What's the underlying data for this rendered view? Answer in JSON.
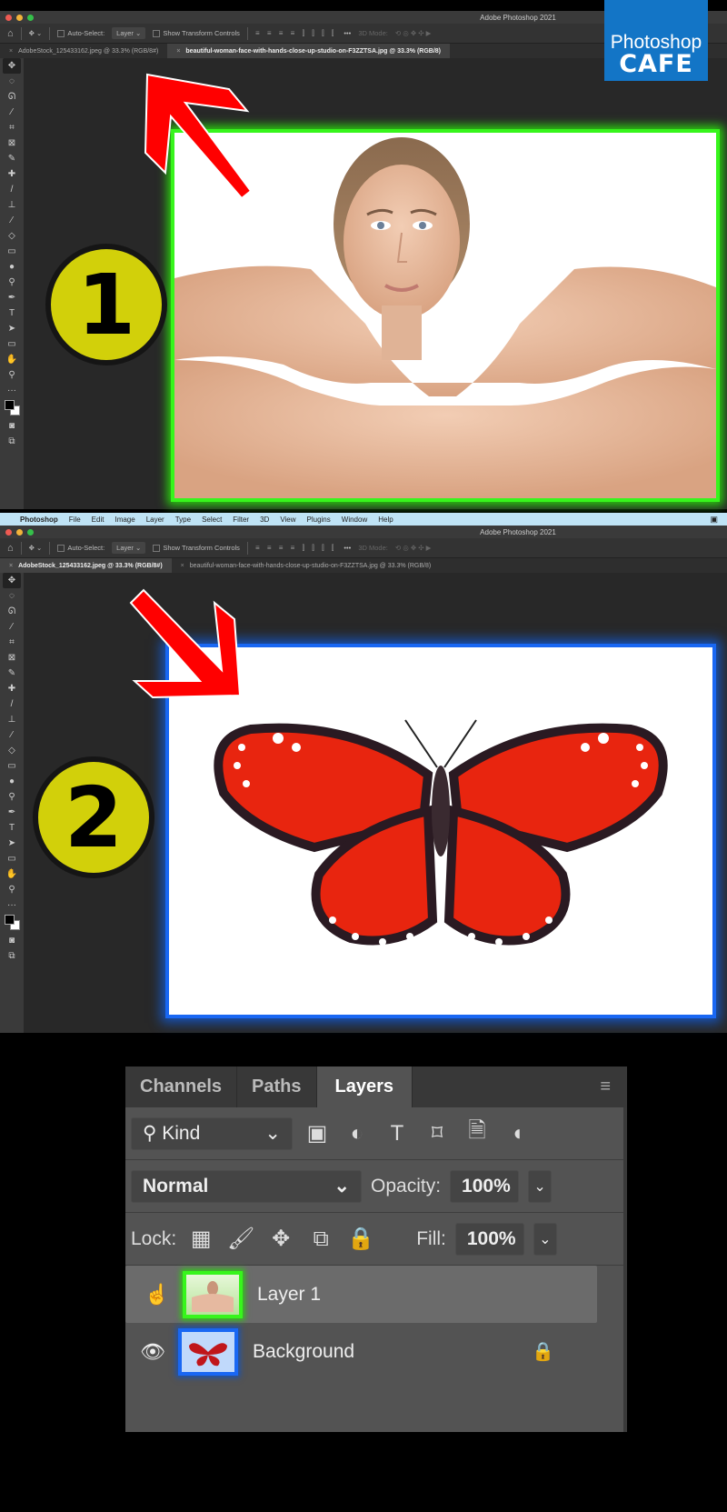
{
  "screens": [
    {
      "window_title": "Adobe Photoshop 2021",
      "options_bar": {
        "auto_select_label": "Auto-Select:",
        "auto_select_value": "Layer",
        "show_transform_label": "Show Transform Controls",
        "more_label": "•••",
        "mode_3d_label": "3D Mode:"
      },
      "tabs": [
        {
          "label": "AdobeStock_125433162.jpeg @ 33.3% (RGB/8#)",
          "active": false
        },
        {
          "label": "beautiful-woman-face-with-hands-close-up-studio-on-F3ZZTSA.jpg @ 33.3% (RGB/8)",
          "active": true
        }
      ],
      "step_badge": "1",
      "document_content": "woman-face-with-hands-photo",
      "highlight_color": "#37f51c"
    },
    {
      "menu_bar": {
        "apple": "",
        "items": [
          "Photoshop",
          "File",
          "Edit",
          "Image",
          "Layer",
          "Type",
          "Select",
          "Filter",
          "3D",
          "View",
          "Plugins",
          "Window",
          "Help"
        ]
      },
      "window_title": "Adobe Photoshop 2021",
      "options_bar": {
        "auto_select_label": "Auto-Select:",
        "auto_select_value": "Layer",
        "show_transform_label": "Show Transform Controls",
        "more_label": "•••",
        "mode_3d_label": "3D Mode:"
      },
      "tabs": [
        {
          "label": "AdobeStock_125433162.jpeg @ 33.3% (RGB/8#)",
          "active": true
        },
        {
          "label": "beautiful-woman-face-with-hands-close-up-studio-on-F3ZZTSA.jpg @ 33.3% (RGB/8)",
          "active": false
        }
      ],
      "step_badge": "2",
      "document_content": "red-butterfly-photo",
      "highlight_color": "#1967f3"
    }
  ],
  "toolbar_tools": [
    "move",
    "marquee",
    "lasso",
    "magic-wand",
    "crop",
    "frame",
    "eyedropper",
    "healing",
    "brush",
    "stamp",
    "history-brush",
    "eraser",
    "gradient",
    "blur",
    "dodge",
    "pen",
    "type",
    "path-select",
    "rectangle",
    "hand",
    "zoom",
    "more"
  ],
  "toolbar_glyphs": [
    "✥",
    "◌",
    "ᘏ",
    "⁄",
    "⌗",
    "⊠",
    "✎",
    "✚",
    "/",
    "⊥",
    "⁄",
    "◇",
    "▭",
    "●",
    "⚲",
    "✒",
    "T",
    "➤",
    "▭",
    "✋",
    "⚲",
    "···"
  ],
  "logo": {
    "line1": "Photoshop",
    "line2": "CAFE"
  },
  "layers_panel": {
    "tabs": [
      {
        "label": "Channels",
        "active": false
      },
      {
        "label": "Paths",
        "active": false
      },
      {
        "label": "Layers",
        "active": true
      }
    ],
    "menu_icon": "≡",
    "filter": {
      "label": "Kind",
      "search_icon": "⚲",
      "chevron": "⌄"
    },
    "filter_icons": [
      "▣",
      "◐",
      "T",
      "⌑",
      "🗎",
      "◖"
    ],
    "blend_mode": "Normal",
    "opacity_label": "Opacity:",
    "opacity_value": "100%",
    "lock_label": "Lock:",
    "lock_icons": [
      "▦",
      "🖌",
      "✥",
      "⧉",
      "🔒"
    ],
    "fill_label": "Fill:",
    "fill_value": "100%",
    "layers": [
      {
        "name": "Layer 1",
        "selected": true,
        "visibility_icon": "☝",
        "thumb": "woman",
        "locked": false
      },
      {
        "name": "Background",
        "selected": false,
        "visibility_icon": "👁",
        "thumb": "butterfly",
        "locked": true
      }
    ]
  }
}
